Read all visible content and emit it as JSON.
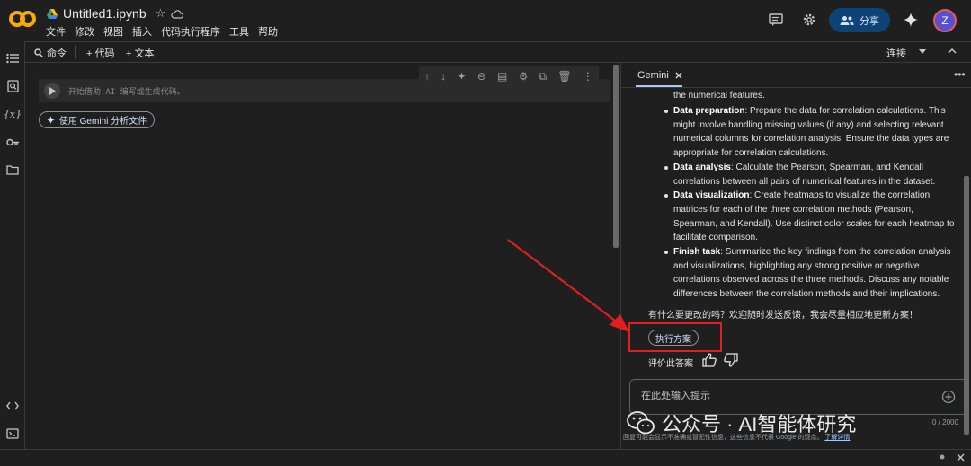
{
  "header": {
    "file_title": "Untitled1.ipynb",
    "menu": [
      "文件",
      "修改",
      "视图",
      "插入",
      "代码执行程序",
      "工具",
      "帮助"
    ],
    "share_label": "分享",
    "avatar_letter": "Z",
    "icons": [
      "comment-icon",
      "settings-icon",
      "share-people-icon",
      "gemini-spark-icon"
    ]
  },
  "toolbar": {
    "command_label": "命令",
    "add_code_label": "+ 代码",
    "add_text_label": "+ 文本",
    "connect_label": "连接"
  },
  "notebook": {
    "cell_placeholder": "开始借助 AI 编写或生成代码。",
    "gemini_file_button": "使用 Gemini 分析文件"
  },
  "gemini_panel": {
    "tab_label": "Gemini",
    "first_line": "the numerical features.",
    "steps": [
      {
        "title": "Data preparation",
        "text": ": Prepare the data for correlation calculations. This might involve handling missing values (if any) and selecting relevant numerical columns for correlation analysis. Ensure the data types are appropriate for correlation calculations."
      },
      {
        "title": "Data analysis",
        "text": ": Calculate the Pearson, Spearman, and Kendall correlations between all pairs of numerical features in the dataset."
      },
      {
        "title": "Data visualization",
        "text": ": Create heatmaps to visualize the correlation matrices for each of the three correlation methods (Pearson, Spearman, and Kendall). Use distinct color scales for each heatmap to facilitate comparison."
      },
      {
        "title": "Finish task",
        "text": ": Summarize the key findings from the correlation analysis and visualizations, highlighting any strong positive or negative correlations observed across the three methods. Discuss any notable differences between the correlation methods and their implications."
      }
    ],
    "followup": "有什么要更改的吗？欢迎随时发送反馈，我会尽量相应地更新方案！",
    "execute_button": "执行方案",
    "rate_label": "评价此答案",
    "prompt_placeholder": "在此处输入提示",
    "char_count": "0 / 2000",
    "disclaimer": "回复可能会显示不准确或冒犯性信息，这些信息不代表 Google 的观点。",
    "disclaimer_link": "了解详情"
  },
  "watermark": {
    "text": "公众号 · AI智能体研究"
  },
  "colors": {
    "background": "#1f1f1f",
    "share_button": "#0e4377",
    "annotation_red": "#e02020",
    "tab_underline": "#a8c7fa"
  }
}
